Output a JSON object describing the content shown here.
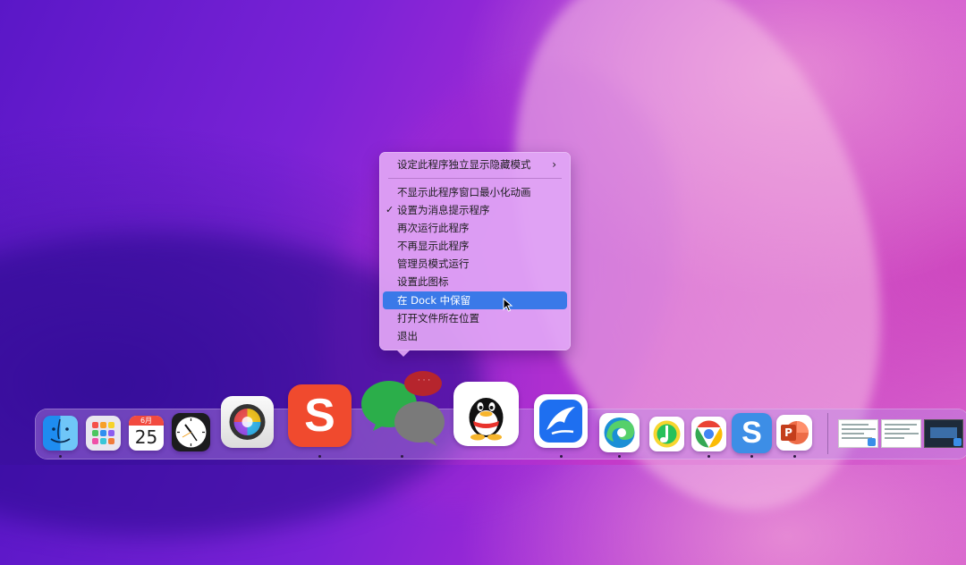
{
  "context_menu": {
    "items": [
      {
        "label": "设定此程序独立显示隐藏模式",
        "submenu_arrow": "›"
      },
      {
        "label": "不显示此程序窗口最小化动画"
      },
      {
        "label": "设置为消息提示程序",
        "check": "✓"
      },
      {
        "label": "再次运行此程序"
      },
      {
        "label": "不再显示此程序"
      },
      {
        "label": "管理员模式运行"
      },
      {
        "label": "设置此图标"
      },
      {
        "label": "在 Dock 中保留",
        "highlighted": true
      },
      {
        "label": "打开文件所在位置"
      },
      {
        "label": "退出"
      }
    ]
  },
  "dock": {
    "calendar_month": "6月",
    "calendar_day": "25",
    "wechat_bubble_dots": "· · ·",
    "sogou_letter": "S",
    "powerpoint_letter": "P",
    "apps": [
      {
        "name": "finder-icon"
      },
      {
        "name": "launchpad-icon"
      },
      {
        "name": "calendar-icon"
      },
      {
        "name": "clock-icon"
      },
      {
        "name": "color-picker-icon"
      },
      {
        "name": "sogou-input-icon"
      },
      {
        "name": "wechat-icon"
      },
      {
        "name": "qq-icon"
      },
      {
        "name": "feishu-icon"
      },
      {
        "name": "edge-icon"
      },
      {
        "name": "qq-music-icon"
      },
      {
        "name": "chrome-icon"
      },
      {
        "name": "sogou-s-icon"
      },
      {
        "name": "powerpoint-icon"
      }
    ]
  },
  "colors": {
    "highlight": "#3a79e8",
    "sogou_red": "#f04a2e",
    "wechat_green": "#2bae4a",
    "powerpoint_orange": "#d24726"
  }
}
